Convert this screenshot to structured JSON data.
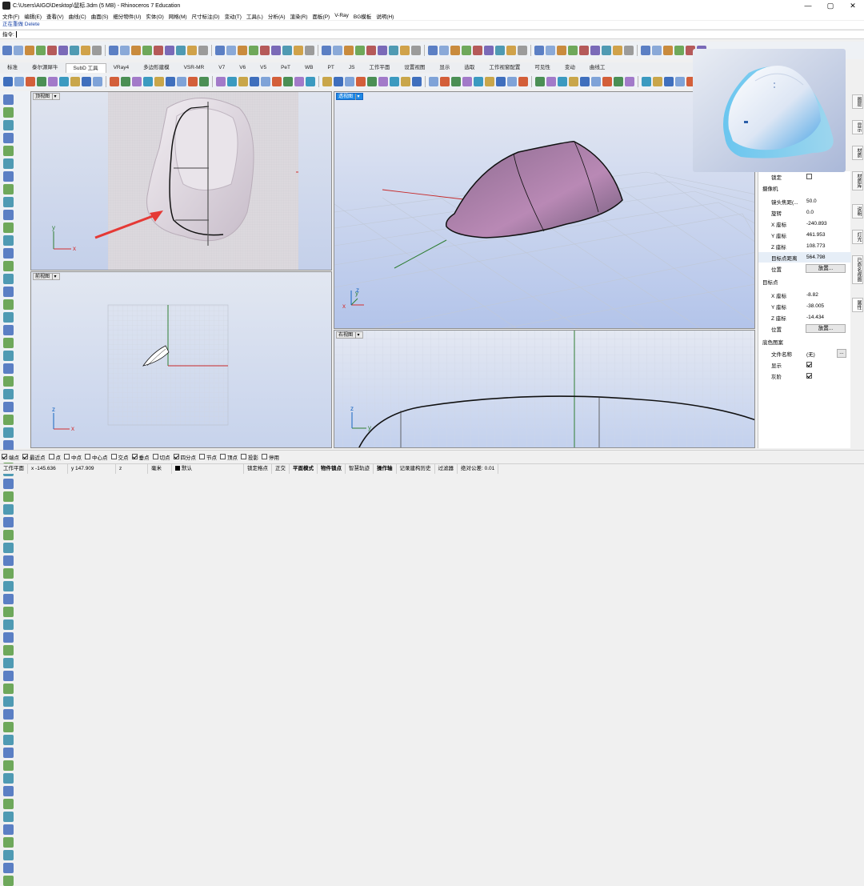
{
  "window": {
    "title": "C:\\Users\\AIGO\\Desktop\\鼠标.3dm (5 MB) - Rhinoceros 7 Education",
    "controls": [
      "—",
      "▢",
      "✕"
    ]
  },
  "menu": [
    "文件(F)",
    "编辑(E)",
    "查看(V)",
    "曲线(C)",
    "曲面(S)",
    "细分物件(U)",
    "实体(O)",
    "网格(M)",
    "尺寸标注(D)",
    "变动(T)",
    "工具(L)",
    "分析(A)",
    "渲染(R)",
    "面板(P)",
    "V-Ray",
    "BG模板",
    "说明(H)"
  ],
  "command": {
    "history": "正在重做 Delete",
    "prompt": "指令:"
  },
  "tabs": [
    "标准",
    "泰尔源犀牛",
    "SubD 工具",
    "VRay4",
    "多边形建模",
    "VSR-MR",
    "V7",
    "V6",
    "V5",
    "PeT",
    "WB",
    "PT",
    "JS",
    "工作平面",
    "设置视图",
    "显示",
    "选取",
    "工作视窗配置",
    "可见性",
    "变动",
    "曲线工"
  ],
  "active_tab": "SubD 工具",
  "viewports": {
    "top": "顶视图",
    "front": "前视图",
    "perspective": "透视图",
    "right": "右视图"
  },
  "properties": {
    "lock_label": "锁定",
    "camera_section": "摄像机",
    "rows": [
      {
        "label": "镜头焦距(...",
        "value": "50.0"
      },
      {
        "label": "旋转",
        "value": "0.0"
      },
      {
        "label": "X 座标",
        "value": "-240.893"
      },
      {
        "label": "Y 座标",
        "value": "461.953"
      },
      {
        "label": "Z 座标",
        "value": "108.773"
      },
      {
        "label": "目标点距离",
        "value": "564.798"
      }
    ],
    "position_label": "位置",
    "place_button": "放置...",
    "target_section": "目标点",
    "target_rows": [
      {
        "label": "X 座标",
        "value": "-8.82"
      },
      {
        "label": "Y 座标",
        "value": "-38.005"
      },
      {
        "label": "Z 座标",
        "value": "-14.434"
      }
    ],
    "target_position_label": "位置",
    "target_place_button": "放置...",
    "bg_section": "底色图案",
    "filename_label": "文件名称",
    "filename_value": "(无)",
    "filename_btn": "...",
    "show_label": "显示",
    "gray_label": "灰阶"
  },
  "side_tabs": [
    "图层",
    "显示",
    "材质",
    "材质库",
    "说明",
    "灯光",
    "已命名视图",
    "属性"
  ],
  "osnaps": [
    {
      "label": "端点",
      "on": true
    },
    {
      "label": "最近点",
      "on": true
    },
    {
      "label": "点",
      "on": false
    },
    {
      "label": "中点",
      "on": false
    },
    {
      "label": "中心点",
      "on": false
    },
    {
      "label": "交点",
      "on": false
    },
    {
      "label": "垂点",
      "on": true
    },
    {
      "label": "切点",
      "on": false
    },
    {
      "label": "四分点",
      "on": true
    },
    {
      "label": "节点",
      "on": false
    },
    {
      "label": "顶点",
      "on": false
    },
    {
      "label": "投影",
      "on": false
    },
    {
      "label": "停用",
      "on": false
    }
  ],
  "status": {
    "cplane": "工作平面",
    "x": "x -145.636",
    "y": "y 147.909",
    "z": "z",
    "units": "毫米",
    "layer": "默认",
    "items": [
      "锁定格点",
      "正交",
      "平面模式",
      "物件锁点",
      "智慧轨迹",
      "操作轴",
      "记录建构历史",
      "过滤器",
      "绝对公差: 0.01"
    ],
    "bold": [
      "平面模式",
      "物件锁点",
      "操作轴"
    ]
  },
  "colors": {
    "accent": "#1e88e5",
    "arrow": "#e53935",
    "xaxis": "#d32f2f",
    "yaxis": "#2e7d32",
    "zaxis": "#1565c0"
  }
}
